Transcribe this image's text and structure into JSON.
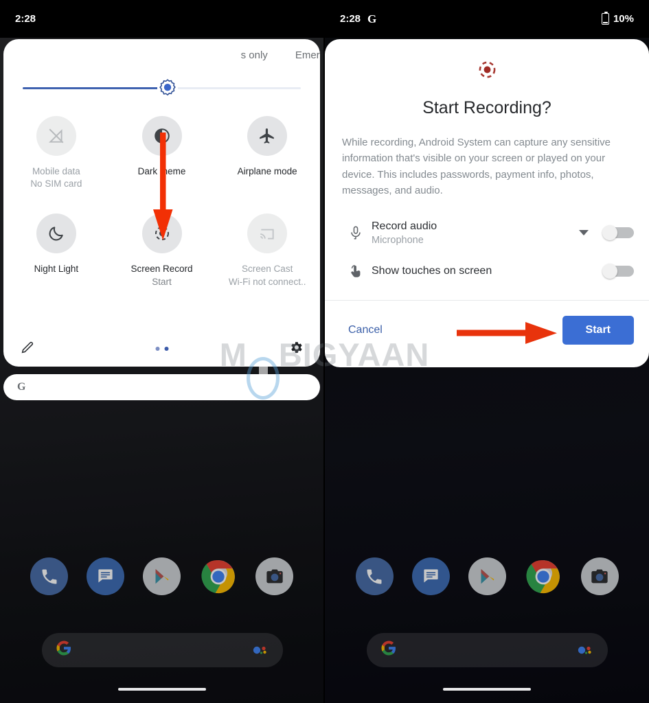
{
  "left_phone": {
    "status_bar": {
      "time": "2:28"
    },
    "quick_settings": {
      "carrier_text": "s only",
      "emergency_text": "Emerg",
      "brightness": {
        "name": "brightness-slider",
        "value_percent": 52
      },
      "tiles": [
        {
          "label": "Mobile data",
          "sub": "No SIM card",
          "icon": "mobile-data-off-icon",
          "enabled": false
        },
        {
          "label": "Dark theme",
          "sub": "",
          "icon": "dark-theme-icon",
          "enabled": true
        },
        {
          "label": "Airplane mode",
          "sub": "",
          "icon": "airplane-icon",
          "enabled": true
        },
        {
          "label": "Night Light",
          "sub": "",
          "icon": "moon-icon",
          "enabled": true
        },
        {
          "label": "Screen Record",
          "sub": "Start",
          "icon": "screen-record-icon",
          "enabled": true
        },
        {
          "label": "Screen Cast",
          "sub": "Wi-Fi not connect..",
          "icon": "cast-icon",
          "enabled": false
        }
      ],
      "footer": {
        "edit_icon": "pencil-icon",
        "settings_icon": "gear-icon",
        "page_dots": 2,
        "active_dot": 2
      }
    },
    "notification_card": {
      "icon": "google-g-icon"
    }
  },
  "right_phone": {
    "status_bar": {
      "time": "2:28",
      "app_icon": "google-g-icon",
      "battery": "10%",
      "battery_icon": "battery-icon"
    },
    "dialog": {
      "icon": "screen-record-icon",
      "title": "Start Recording?",
      "body": "While recording, Android System can capture any sensitive information that's visible on your screen or played on your device. This includes passwords, payment info, photos, messages, and audio.",
      "options": [
        {
          "icon": "microphone-icon",
          "title": "Record audio",
          "sub": "Microphone",
          "has_dropdown": true,
          "toggle_on": false
        },
        {
          "icon": "touch-icon",
          "title": "Show touches on screen",
          "sub": "",
          "has_dropdown": false,
          "toggle_on": false
        }
      ],
      "cancel_label": "Cancel",
      "start_label": "Start"
    }
  },
  "home_screen": {
    "dock_apps": [
      "phone-icon",
      "messages-icon",
      "play-store-icon",
      "chrome-icon",
      "camera-icon"
    ],
    "search_bar": {
      "leading_icon": "google-g-icon",
      "trailing_icon": "assistant-mic-icon"
    },
    "nav_pill": "gesture-nav-pill"
  },
  "annotations": {
    "arrow_down": {
      "name": "red-down-arrow",
      "color": "#F23005"
    },
    "arrow_right": {
      "name": "red-right-arrow",
      "color": "#E8330C"
    }
  },
  "watermark": {
    "text_part1": "M",
    "text_part2": "BIGYAAN",
    "color": "#787E85"
  }
}
